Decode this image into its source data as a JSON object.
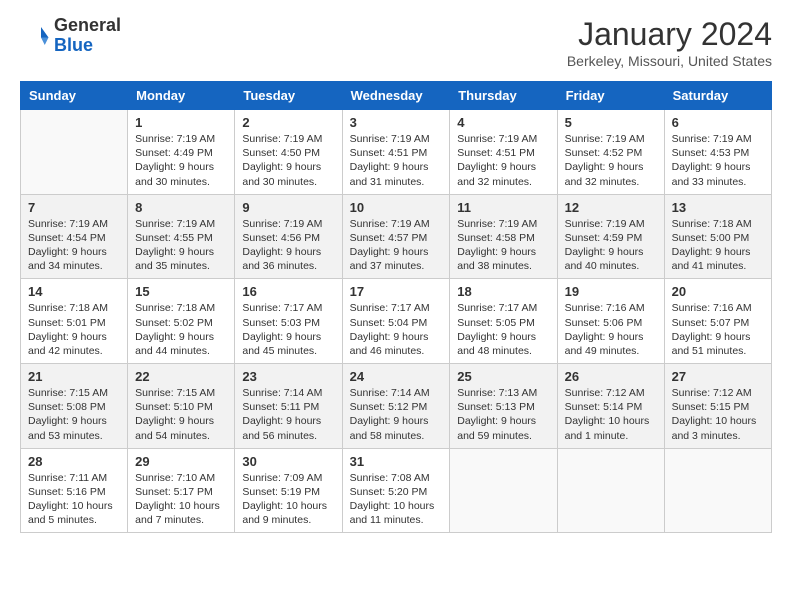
{
  "header": {
    "logo_line1": "General",
    "logo_line2": "Blue",
    "month": "January 2024",
    "location": "Berkeley, Missouri, United States"
  },
  "days_of_week": [
    "Sunday",
    "Monday",
    "Tuesday",
    "Wednesday",
    "Thursday",
    "Friday",
    "Saturday"
  ],
  "weeks": [
    [
      {
        "day": "",
        "info": ""
      },
      {
        "day": "1",
        "info": "Sunrise: 7:19 AM\nSunset: 4:49 PM\nDaylight: 9 hours\nand 30 minutes."
      },
      {
        "day": "2",
        "info": "Sunrise: 7:19 AM\nSunset: 4:50 PM\nDaylight: 9 hours\nand 30 minutes."
      },
      {
        "day": "3",
        "info": "Sunrise: 7:19 AM\nSunset: 4:51 PM\nDaylight: 9 hours\nand 31 minutes."
      },
      {
        "day": "4",
        "info": "Sunrise: 7:19 AM\nSunset: 4:51 PM\nDaylight: 9 hours\nand 32 minutes."
      },
      {
        "day": "5",
        "info": "Sunrise: 7:19 AM\nSunset: 4:52 PM\nDaylight: 9 hours\nand 32 minutes."
      },
      {
        "day": "6",
        "info": "Sunrise: 7:19 AM\nSunset: 4:53 PM\nDaylight: 9 hours\nand 33 minutes."
      }
    ],
    [
      {
        "day": "7",
        "info": "Sunrise: 7:19 AM\nSunset: 4:54 PM\nDaylight: 9 hours\nand 34 minutes."
      },
      {
        "day": "8",
        "info": "Sunrise: 7:19 AM\nSunset: 4:55 PM\nDaylight: 9 hours\nand 35 minutes."
      },
      {
        "day": "9",
        "info": "Sunrise: 7:19 AM\nSunset: 4:56 PM\nDaylight: 9 hours\nand 36 minutes."
      },
      {
        "day": "10",
        "info": "Sunrise: 7:19 AM\nSunset: 4:57 PM\nDaylight: 9 hours\nand 37 minutes."
      },
      {
        "day": "11",
        "info": "Sunrise: 7:19 AM\nSunset: 4:58 PM\nDaylight: 9 hours\nand 38 minutes."
      },
      {
        "day": "12",
        "info": "Sunrise: 7:19 AM\nSunset: 4:59 PM\nDaylight: 9 hours\nand 40 minutes."
      },
      {
        "day": "13",
        "info": "Sunrise: 7:18 AM\nSunset: 5:00 PM\nDaylight: 9 hours\nand 41 minutes."
      }
    ],
    [
      {
        "day": "14",
        "info": "Sunrise: 7:18 AM\nSunset: 5:01 PM\nDaylight: 9 hours\nand 42 minutes."
      },
      {
        "day": "15",
        "info": "Sunrise: 7:18 AM\nSunset: 5:02 PM\nDaylight: 9 hours\nand 44 minutes."
      },
      {
        "day": "16",
        "info": "Sunrise: 7:17 AM\nSunset: 5:03 PM\nDaylight: 9 hours\nand 45 minutes."
      },
      {
        "day": "17",
        "info": "Sunrise: 7:17 AM\nSunset: 5:04 PM\nDaylight: 9 hours\nand 46 minutes."
      },
      {
        "day": "18",
        "info": "Sunrise: 7:17 AM\nSunset: 5:05 PM\nDaylight: 9 hours\nand 48 minutes."
      },
      {
        "day": "19",
        "info": "Sunrise: 7:16 AM\nSunset: 5:06 PM\nDaylight: 9 hours\nand 49 minutes."
      },
      {
        "day": "20",
        "info": "Sunrise: 7:16 AM\nSunset: 5:07 PM\nDaylight: 9 hours\nand 51 minutes."
      }
    ],
    [
      {
        "day": "21",
        "info": "Sunrise: 7:15 AM\nSunset: 5:08 PM\nDaylight: 9 hours\nand 53 minutes."
      },
      {
        "day": "22",
        "info": "Sunrise: 7:15 AM\nSunset: 5:10 PM\nDaylight: 9 hours\nand 54 minutes."
      },
      {
        "day": "23",
        "info": "Sunrise: 7:14 AM\nSunset: 5:11 PM\nDaylight: 9 hours\nand 56 minutes."
      },
      {
        "day": "24",
        "info": "Sunrise: 7:14 AM\nSunset: 5:12 PM\nDaylight: 9 hours\nand 58 minutes."
      },
      {
        "day": "25",
        "info": "Sunrise: 7:13 AM\nSunset: 5:13 PM\nDaylight: 9 hours\nand 59 minutes."
      },
      {
        "day": "26",
        "info": "Sunrise: 7:12 AM\nSunset: 5:14 PM\nDaylight: 10 hours\nand 1 minute."
      },
      {
        "day": "27",
        "info": "Sunrise: 7:12 AM\nSunset: 5:15 PM\nDaylight: 10 hours\nand 3 minutes."
      }
    ],
    [
      {
        "day": "28",
        "info": "Sunrise: 7:11 AM\nSunset: 5:16 PM\nDaylight: 10 hours\nand 5 minutes."
      },
      {
        "day": "29",
        "info": "Sunrise: 7:10 AM\nSunset: 5:17 PM\nDaylight: 10 hours\nand 7 minutes."
      },
      {
        "day": "30",
        "info": "Sunrise: 7:09 AM\nSunset: 5:19 PM\nDaylight: 10 hours\nand 9 minutes."
      },
      {
        "day": "31",
        "info": "Sunrise: 7:08 AM\nSunset: 5:20 PM\nDaylight: 10 hours\nand 11 minutes."
      },
      {
        "day": "",
        "info": ""
      },
      {
        "day": "",
        "info": ""
      },
      {
        "day": "",
        "info": ""
      }
    ]
  ]
}
